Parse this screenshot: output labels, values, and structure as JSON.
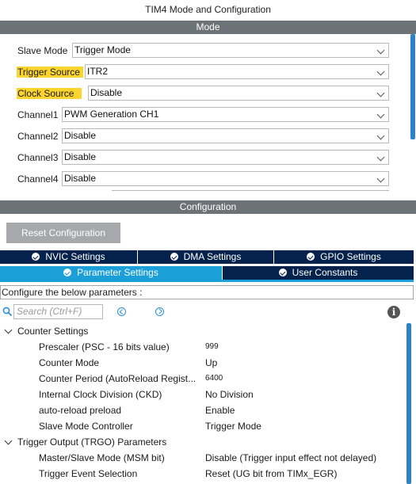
{
  "window": {
    "title": "TIM4 Mode and Configuration"
  },
  "mode": {
    "header": "Mode",
    "rows": [
      {
        "label": "Slave Mode",
        "value": "Trigger Mode",
        "highlighted": false
      },
      {
        "label": "Trigger Source",
        "value": "ITR2",
        "highlighted": true
      },
      {
        "label": "Clock Source",
        "value": "Disable",
        "highlighted": true
      },
      {
        "label": "Channel1",
        "value": "PWM Generation CH1",
        "highlighted": false
      },
      {
        "label": "Channel2",
        "value": "Disable",
        "highlighted": false
      },
      {
        "label": "Channel3",
        "value": "Disable",
        "highlighted": false
      },
      {
        "label": "Channel4",
        "value": "Disable",
        "highlighted": false
      }
    ]
  },
  "configuration": {
    "header": "Configuration",
    "reset_button": "Reset Configuration",
    "tabs_row1": [
      {
        "label": "NVIC Settings",
        "checked": true
      },
      {
        "label": "DMA Settings",
        "checked": true
      },
      {
        "label": "GPIO Settings",
        "checked": true
      }
    ],
    "tabs_row2": [
      {
        "label": "Parameter Settings",
        "checked": true,
        "active": true
      },
      {
        "label": "User Constants",
        "checked": true,
        "active": false
      }
    ],
    "description": "Configure the below parameters :",
    "search": {
      "placeholder": "Search (Ctrl+F)"
    },
    "info_glyph": "i",
    "groups": [
      {
        "label": "Counter Settings",
        "params": [
          {
            "name": "Prescaler (PSC - 16 bits value)",
            "value": "999",
            "small": true
          },
          {
            "name": "Counter Mode",
            "value": "Up",
            "small": false
          },
          {
            "name": "Counter Period (AutoReload Regist...",
            "value": "6400",
            "small": true
          },
          {
            "name": "Internal Clock Division (CKD)",
            "value": "No Division",
            "small": false
          },
          {
            "name": "auto-reload preload",
            "value": "Enable",
            "small": false
          },
          {
            "name": "Slave Mode Controller",
            "value": "Trigger Mode",
            "small": false
          }
        ]
      },
      {
        "label": "Trigger Output (TRGO) Parameters",
        "params": [
          {
            "name": "Master/Slave Mode (MSM bit)",
            "value": "Disable (Trigger input effect not delayed)",
            "small": false
          },
          {
            "name": "Trigger Event Selection",
            "value": "Reset (UG bit from TIMx_EGR)",
            "small": false
          }
        ]
      }
    ]
  },
  "colors": {
    "section_bar": "#6d7276",
    "tab_dark": "#04224b",
    "tab_active": "#1a9fd9",
    "highlight": "#fbd52d",
    "scrollbar": "#2b83c6",
    "reset_button": "#a6a8ab"
  }
}
